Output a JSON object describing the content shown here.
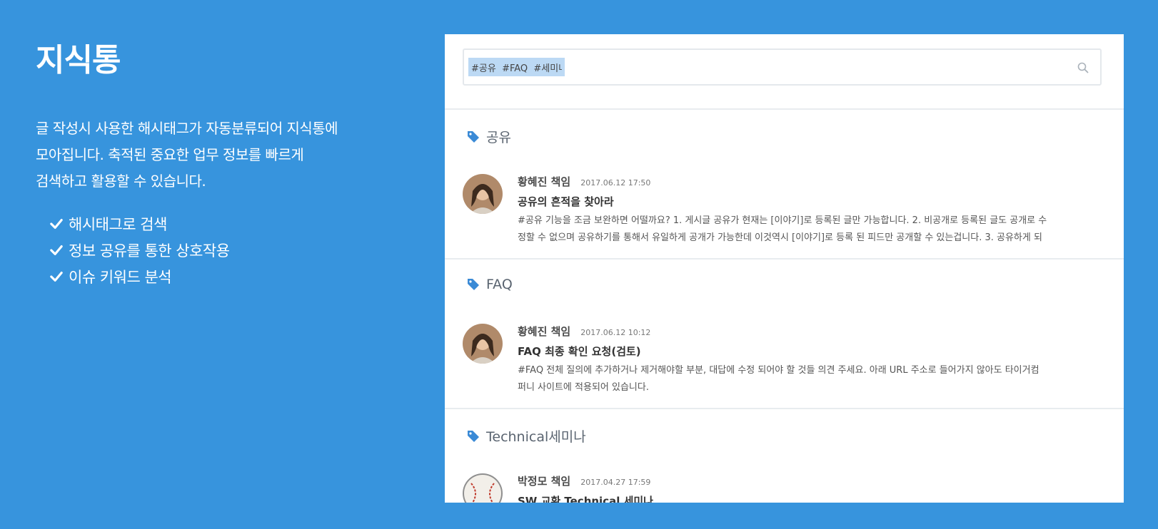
{
  "hero": {
    "title": "지식통",
    "description_lines": [
      "글 작성시 사용한 해시태그가 자동분류되어 지식통에",
      "모아집니다. 축적된 중요한 업무 정보를 빠르게",
      "검색하고 활용할 수 있습니다."
    ],
    "features": [
      "해시태그로 검색",
      "정보 공유를 통한 상호작용",
      "이슈 키워드 분석"
    ],
    "feature_icon": "check-icon"
  },
  "search": {
    "value": "#공유  #FAQ  #세미나",
    "icon": "search-icon"
  },
  "sections": [
    {
      "label": "공유",
      "icon": "tag-icon",
      "post": {
        "author": "황혜진 책임",
        "date": "2017.06.12 17:50",
        "title": "공유의 흔적을 찾아라",
        "excerpt_lines": [
          "#공유 기능을 조금 보완하면 어떨까요? 1. 게시글 공유가 현재는 [이야기]로 등록된 글만 가능합니다. 2. 비공개로 등록된 글도 공개로 수",
          "정할 수 없으며 공유하기를 통해서 유일하게 공개가 가능한데 이것역시 [이야기]로 등록 된 피드만 공개할 수 있는겁니다. 3. 공유하게 되"
        ]
      }
    },
    {
      "label": "FAQ",
      "icon": "tag-icon",
      "post": {
        "author": "황혜진 책임",
        "date": "2017.06.12 10:12",
        "title": "FAQ 최종 확인 요청(검토)",
        "excerpt_lines": [
          "#FAQ 전체 질의에 추가하거나 제거해야할 부분, 대답에 수정 되어야 할 것들 의견 주세요. 아래 URL 주소로 들어가지 않아도 타이거컴",
          "퍼니 사이트에 적용되어 있습니다."
        ]
      }
    },
    {
      "label": "Technical세미나",
      "icon": "tag-icon",
      "post": {
        "author": "박정모 책임",
        "date": "2017.04.27 17:59",
        "title": "SW 교환 Technical 세미나",
        "excerpt_lines": []
      }
    }
  ],
  "colors": {
    "background": "#3794dd",
    "tag_icon": "#3a8ad6"
  }
}
